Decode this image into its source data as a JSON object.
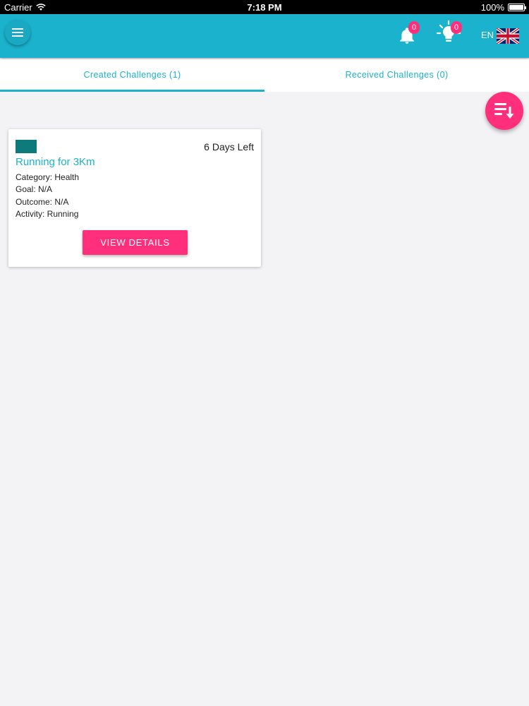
{
  "statusbar": {
    "carrier": "Carrier",
    "time": "7:18 PM",
    "battery": "100%"
  },
  "appbar": {
    "notifications_count": "0",
    "ideas_count": "0",
    "language": "EN"
  },
  "tabs": [
    {
      "label": "Created Challenges (1)",
      "active": true
    },
    {
      "label": "Received Challenges (0)",
      "active": false
    }
  ],
  "card": {
    "days_left": "6 Days Left",
    "title": "Running for 3Km",
    "category": "Category: Health",
    "goal": "Goal: N/A",
    "outcome": "Outcome: N/A",
    "activity": "Activity: Running",
    "button_label": "VIEW DETAILS"
  },
  "icons": {
    "menu": "hamburger-menu-icon",
    "notifications": "bell-icon",
    "ideas": "lightbulb-icon",
    "language_flag": "uk-flag-icon",
    "sort": "sort-list-icon"
  },
  "colors": {
    "primary": "#1bb2cd",
    "accent": "#ff2f7b",
    "swatch": "#0d7b7b",
    "background": "#f3f2f5"
  }
}
